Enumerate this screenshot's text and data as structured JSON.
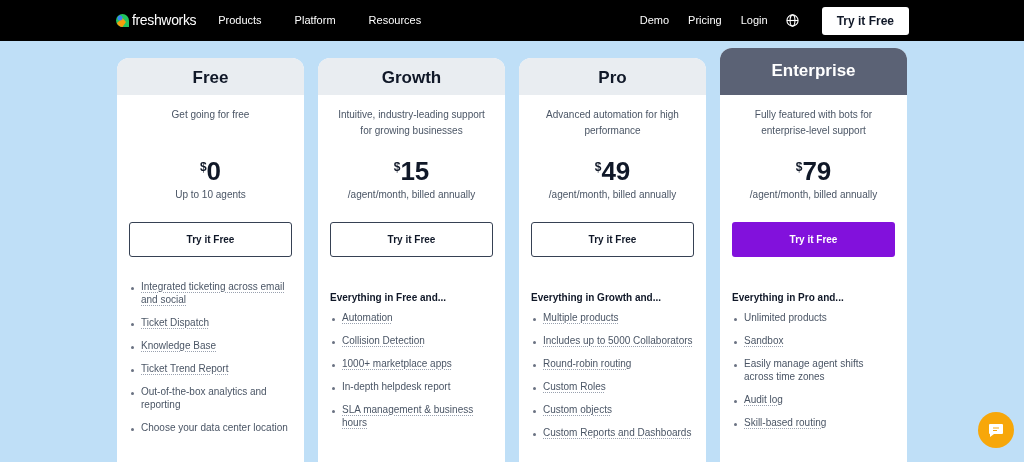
{
  "nav": {
    "logo": "freshworks",
    "links": [
      "Products",
      "Platform",
      "Resources"
    ],
    "right_links": [
      "Demo",
      "Pricing",
      "Login"
    ],
    "cta": "Try it Free"
  },
  "plans": [
    {
      "name": "Free",
      "highlighted": false,
      "tagline": "Get going for free",
      "currency": "$",
      "amount": "0",
      "period": "Up to 10 agents",
      "button": "Try it Free",
      "features": [
        {
          "text": "Integrated ticketing across email and social",
          "underlined": true
        },
        {
          "text": "Ticket Dispatch",
          "underlined": true
        },
        {
          "text": "Knowledge Base",
          "underlined": true
        },
        {
          "text": "Ticket Trend Report",
          "underlined": true
        },
        {
          "text": "Out-of-the-box analytics and reporting",
          "underlined": false
        },
        {
          "text": "Choose your data center location",
          "underlined": false
        }
      ]
    },
    {
      "name": "Growth",
      "highlighted": false,
      "tagline": "Intuitive, industry-leading support for growing businesses",
      "currency": "$",
      "amount": "15",
      "period": "/agent/month, billed annually",
      "button": "Try it Free",
      "features_heading": "Everything in Free and...",
      "features": [
        {
          "text": "Automation",
          "underlined": true
        },
        {
          "text": "Collision Detection",
          "underlined": true
        },
        {
          "text": "1000+ marketplace apps",
          "underlined": true
        },
        {
          "text": "In-depth helpdesk report",
          "underlined": false
        },
        {
          "text": "SLA management & business hours",
          "underlined": true
        }
      ]
    },
    {
      "name": "Pro",
      "highlighted": false,
      "tagline": "Advanced automation for high performance",
      "currency": "$",
      "amount": "49",
      "period": "/agent/month, billed annually",
      "button": "Try it Free",
      "features_heading": "Everything in Growth and...",
      "features": [
        {
          "text": "Multiple products",
          "underlined": true
        },
        {
          "text": "Includes up to 5000 Collaborators",
          "underlined": true
        },
        {
          "text": "Round-robin routing",
          "underlined": true
        },
        {
          "text": "Custom Roles",
          "underlined": true
        },
        {
          "text": "Custom objects",
          "underlined": true
        },
        {
          "text": "Custom Reports and Dashboards",
          "underlined": true
        }
      ]
    },
    {
      "name": "Enterprise",
      "highlighted": true,
      "tagline": "Fully featured with bots for enterprise-level support",
      "currency": "$",
      "amount": "79",
      "period": "/agent/month, billed annually",
      "button": "Try it Free",
      "features_heading": "Everything in Pro and...",
      "features": [
        {
          "text": "Unlimited products",
          "underlined": false
        },
        {
          "text": "Sandbox",
          "underlined": true
        },
        {
          "text": "Easily manage agent shifts across time zones",
          "underlined": false
        },
        {
          "text": "Audit log",
          "underlined": true
        },
        {
          "text": "Skill-based routing",
          "underlined": true
        }
      ]
    }
  ]
}
